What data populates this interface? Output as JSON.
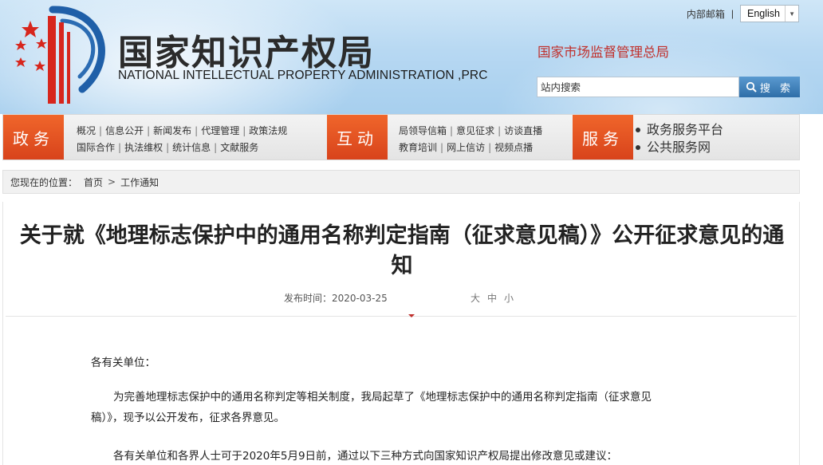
{
  "header": {
    "logo_cn": "国家知识产权局",
    "logo_en": "NATIONAL INTELLECTUAL PROPERTY ADMINISTRATION ,PRC",
    "mail_label": "内部邮箱",
    "mail_sep": "|",
    "language_selected": "English",
    "samr_link": "国家市场监督管理总局",
    "search_placeholder": "站内搜索",
    "search_button": "搜 索",
    "colors": {
      "accent_red": "#c0312d",
      "nav_orange": "#e4532a",
      "sky_blue": "#b7d8f2"
    }
  },
  "nav": {
    "gov_label": "政务",
    "gov_links_row1": [
      "概况",
      "信息公开",
      "新闻发布",
      "代理管理",
      "政策法规"
    ],
    "gov_links_row2": [
      "国际合作",
      "执法维权",
      "统计信息",
      "文献服务"
    ],
    "interact_label": "互动",
    "interact_links_row1": [
      "局领导信箱",
      "意见征求",
      "访谈直播"
    ],
    "interact_links_row2": [
      "教育培训",
      "网上信访",
      "视频点播"
    ],
    "service_label": "服务",
    "service_links": [
      "政务服务平台",
      "公共服务网"
    ]
  },
  "breadcrumb": {
    "prefix": "您现在的位置：",
    "home": "首页",
    "separator": ">",
    "current": "工作通知"
  },
  "article": {
    "title": "关于就《地理标志保护中的通用名称判定指南（征求意见稿）》公开征求意见的通知",
    "date_label": "发布时间：2020-03-25",
    "font_sizes": [
      "大",
      "中",
      "小"
    ],
    "greeting": "各有关单位：",
    "paragraph1": "为完善地理标志保护中的通用名称判定等相关制度，我局起草了《地理标志保护中的通用名称判定指南（征求意见稿）》，现予以公开发布，征求各界意见。",
    "paragraph2": "各有关单位和各界人士可于2020年5月9日前，通过以下三种方式向国家知识产权局提出修改意见或建议："
  }
}
